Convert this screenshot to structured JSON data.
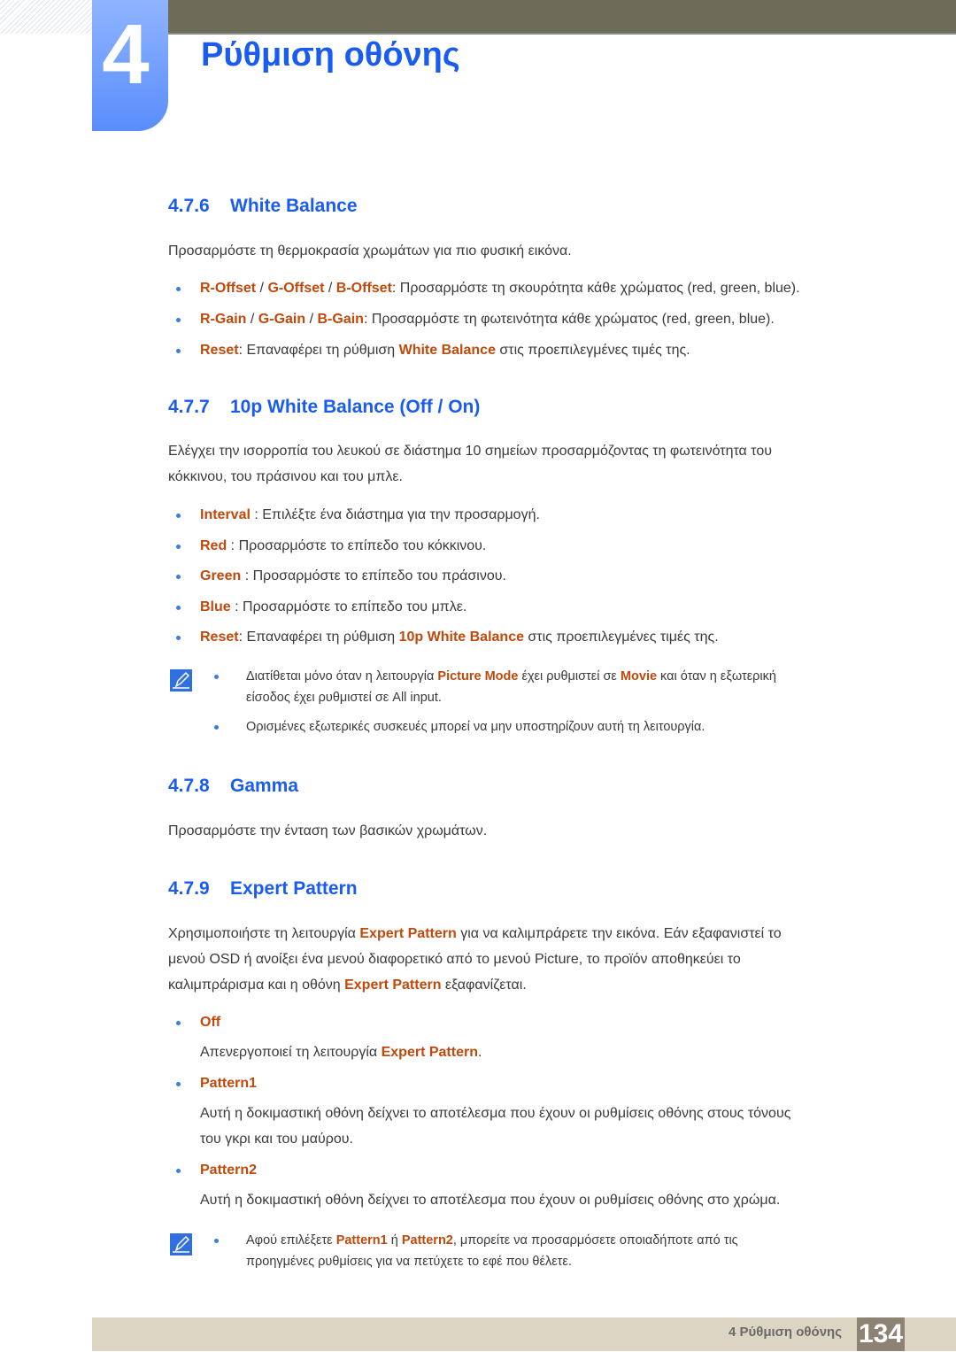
{
  "chapter": {
    "number": "4",
    "title": "Ρύθμιση οθόνης"
  },
  "colors": {
    "heading_blue": "#1a5cf0",
    "highlight_orange": "#c0490b",
    "top_bar": "#6d6c58",
    "footer_bg": "#dcd5c3",
    "page_num_bg": "#8e8274",
    "bullet_blue": "#3b7de0"
  },
  "sections": {
    "wb": {
      "num": "4.7.6",
      "title": "White Balance",
      "intro": "Προσαρμόστε τη θερμοκρασία χρωμάτων για πιο φυσική εικόνα.",
      "items": [
        {
          "t1": "R-Offset",
          "s1": " / ",
          "t2": "G-Offset",
          "s2": " / ",
          "t3": "B-Offset",
          "rest": ": Προσαρμόστε τη σκουρότητα κάθε χρώματος (red, green, blue)."
        },
        {
          "t1": "R-Gain",
          "s1": " / ",
          "t2": "G-Gain",
          "s2": " / ",
          "t3": "B-Gain",
          "rest": ": Προσαρμόστε τη φωτεινότητα κάθε χρώματος (red, green, blue)."
        },
        {
          "t1": "Reset",
          "mid": ": Επαναφέρει τη ρύθμιση ",
          "t2": "White Balance",
          "rest": " στις προεπιλεγμένες τιμές της."
        }
      ]
    },
    "wb10": {
      "num": "4.7.7",
      "title": "10p White Balance (Off / On)",
      "intro1": "Ελέγχει την ισορροπία του λευκού σε διάστημα 10 σημείων προσαρμόζοντας τη φωτεινότητα του",
      "intro2": "κόκκινου, του πράσινου και του μπλε.",
      "items": [
        {
          "t1": "Interval",
          "rest": " : Επιλέξτε ένα διάστημα για την προσαρμογή."
        },
        {
          "t1": "Red",
          "rest": " : Προσαρμόστε το επίπεδο του κόκκινου."
        },
        {
          "t1": "Green",
          "rest": " : Προσαρμόστε το επίπεδο του πράσινου."
        },
        {
          "t1": "Blue",
          "rest": " : Προσαρμόστε το επίπεδο του μπλε."
        },
        {
          "t1": "Reset",
          "mid": ": Επαναφέρει τη ρύθμιση ",
          "t2": "10p White Balance",
          "rest": " στις προεπιλεγμένες τιμές της."
        }
      ],
      "notes": [
        {
          "a": "Διατίθεται μόνο όταν η λειτουργία ",
          "b": "Picture Mode",
          "c": " έχει ρυθμιστεί σε ",
          "d": "Movie",
          "e": " και όταν η εξωτερική",
          "f": "είσοδος έχει ρυθμιστεί σε All input."
        },
        {
          "a": "Ορισμένες εξωτερικές συσκευές μπορεί να μην υποστηρίζουν αυτή τη λειτουργία."
        }
      ]
    },
    "gamma": {
      "num": "4.7.8",
      "title": "Gamma",
      "intro": "Προσαρμόστε την ένταση των βασικών χρωμάτων."
    },
    "expert": {
      "num": "4.7.9",
      "title": "Expert Pattern",
      "p1a": "Χρησιμοποιήστε τη λειτουργία ",
      "p1b": "Expert Pattern",
      "p1c": " για να καλιμπράρετε την εικόνα. Εάν εξαφανιστεί το",
      "p2": "μενού OSD ή ανοίξει ένα μενού διαφορετικό από το μενού Picture, το προϊόν αποθηκεύει το",
      "p3a": "καλιμπράρισμα και η οθόνη ",
      "p3b": "Expert Pattern",
      "p3c": " εξαφανίζεται.",
      "items": [
        {
          "label": "Off",
          "d1a": "Απενεργοποιεί τη λειτουργία ",
          "d1b": "Expert Pattern",
          "d1c": "."
        },
        {
          "label": "Pattern1",
          "d1": "Αυτή η δοκιμαστική οθόνη δείχνει το αποτέλεσμα που έχουν οι ρυθμίσεις οθόνης στους τόνους",
          "d2": "του γκρι και του μαύρου."
        },
        {
          "label": "Pattern2",
          "d1": "Αυτή η δοκιμαστική οθόνη δείχνει το αποτέλεσμα που έχουν οι ρυθμίσεις οθόνης στο χρώμα."
        }
      ],
      "note": {
        "a": "Αφού επιλέξετε ",
        "b": "Pattern1",
        "c": " ή ",
        "d": "Pattern2",
        "e": ", μπορείτε να προσαρμόσετε οποιαδήποτε από τις",
        "f": "προηγμένες ρυθμίσεις για να πετύχετε το εφέ που θέλετε."
      }
    }
  },
  "footer": {
    "label": "4 Ρύθμιση οθόνης",
    "page": "134"
  },
  "icons": {
    "note": "note-pencil-icon",
    "bullet": "bullet-dot-icon"
  }
}
